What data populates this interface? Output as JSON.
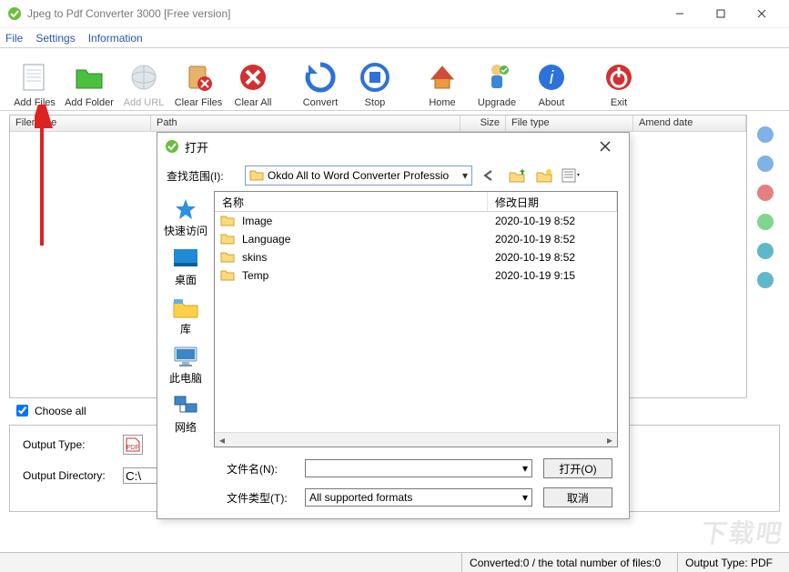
{
  "window": {
    "title": "Jpeg to Pdf Converter 3000 [Free version]"
  },
  "menu": {
    "file": "File",
    "settings": "Settings",
    "information": "Information"
  },
  "toolbar": {
    "addFiles": "Add Files",
    "addFolder": "Add Folder",
    "addUrl": "Add URL",
    "clearFiles": "Clear Files",
    "clearAll": "Clear All",
    "convert": "Convert",
    "stop": "Stop",
    "home": "Home",
    "upgrade": "Upgrade",
    "about": "About",
    "exit": "Exit"
  },
  "filelist": {
    "cols": {
      "filename": "Filename",
      "path": "Path",
      "size": "Size",
      "filetype": "File type",
      "amend": "Amend date"
    }
  },
  "chooseAll": "Choose all",
  "bottom": {
    "outputType": "Output Type:",
    "outputDir": "Output Directory:",
    "outputDirValue": "C:\\"
  },
  "status": {
    "converted": "Converted:0",
    "total": "the total number of files:0",
    "outputType": "Output Type: PDF"
  },
  "openDialog": {
    "title": "打开",
    "lookInLabel": "查找范围(I):",
    "lookInValue": "Okdo All to Word Converter Professio",
    "columns": {
      "name": "名称",
      "date": "修改日期"
    },
    "places": {
      "quick": "快速访问",
      "desktop": "桌面",
      "libraries": "库",
      "thispc": "此电脑",
      "network": "网络"
    },
    "rows": [
      {
        "name": "Image",
        "date": "2020-10-19 8:52"
      },
      {
        "name": "Language",
        "date": "2020-10-19 8:52"
      },
      {
        "name": "skins",
        "date": "2020-10-19 8:52"
      },
      {
        "name": "Temp",
        "date": "2020-10-19 9:15"
      }
    ],
    "fileNameLabel": "文件名(N):",
    "fileTypeLabel": "文件类型(T):",
    "fileTypeValue": "All supported formats",
    "openBtn": "打开(O)",
    "cancelBtn": "取消"
  }
}
